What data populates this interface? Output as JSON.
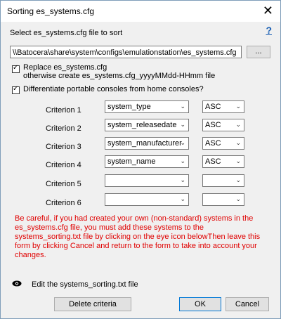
{
  "window": {
    "title": "Sorting es_systems.cfg",
    "close_glyph": "✕"
  },
  "select_label": "Select es_systems.cfg file to sort",
  "help_glyph": "?",
  "file_path": "\\\\Batocera\\share\\system\\configs\\emulationstation\\es_systems.cfg",
  "browse_label": "...",
  "replace": {
    "checked": true,
    "label": "Replace es_systems.cfg",
    "sublabel": "otherwise create es_systems.cfg_yyyyMMdd-HHmm file"
  },
  "differentiate": {
    "checked": true,
    "label": "Differentiate portable consoles from home consoles?"
  },
  "criteria": [
    {
      "label": "Criterion 1",
      "field": "system_type",
      "order": "ASC"
    },
    {
      "label": "Criterion 2",
      "field": "system_releasedate",
      "order": "ASC"
    },
    {
      "label": "Criterion 3",
      "field": "system_manufacturer",
      "order": "ASC"
    },
    {
      "label": "Criterion 4",
      "field": "system_name",
      "order": "ASC"
    },
    {
      "label": "Criterion 5",
      "field": "",
      "order": ""
    },
    {
      "label": "Criterion 6",
      "field": "",
      "order": ""
    }
  ],
  "warning_text": "Be careful, if you had created your own (non-standard) systems in the es_systems.cfg file, you must add these systems to the systems_sorting.txt file by clicking on the eye icon belowThen leave this form by clicking Cancel and return to the form to take into account your changes.",
  "edit_label": "Edit the systems_sorting.txt file",
  "buttons": {
    "delete": "Delete criteria",
    "ok": "OK",
    "cancel": "Cancel"
  },
  "colors": {
    "warning": "#e00000",
    "help": "#1a5fb4",
    "primary_border": "#0078d7"
  }
}
